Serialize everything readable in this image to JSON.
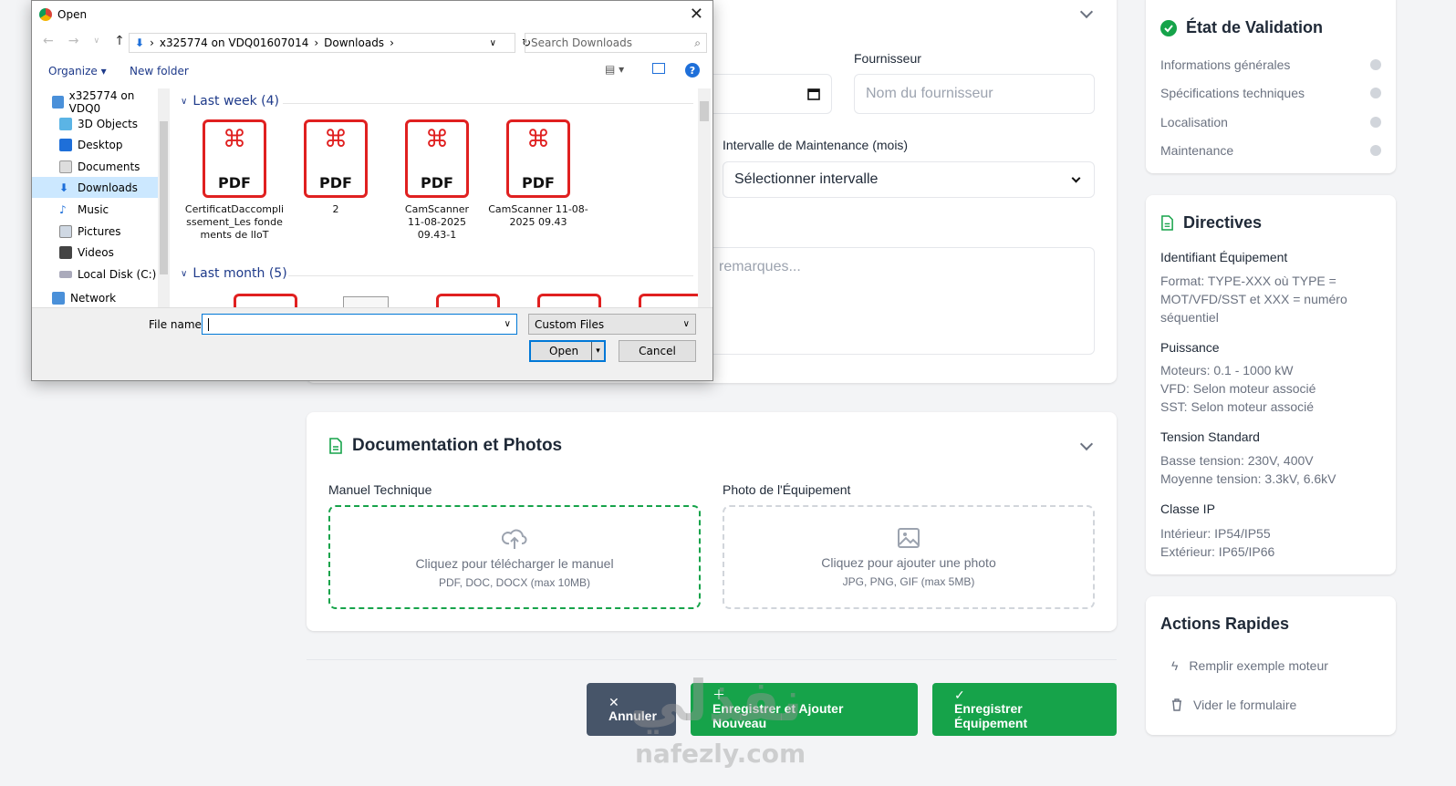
{
  "form": {
    "supplier_label": "Fournisseur",
    "supplier_placeholder": "Nom du fournisseur",
    "maintenance_label": "Intervalle de Maintenance (mois)",
    "maintenance_value": "Sélectionner intervalle",
    "remarks_placeholder": "remarques..."
  },
  "documentation": {
    "title": "Documentation et Photos",
    "manual_label": "Manuel Technique",
    "manual_cta": "Cliquez pour télécharger le manuel",
    "manual_formats": "PDF, DOC, DOCX (max 10MB)",
    "photo_label": "Photo de l'Équipement",
    "photo_cta": "Cliquez pour ajouter une photo",
    "photo_formats": "JPG, PNG, GIF (max 5MB)"
  },
  "buttons": {
    "cancel": "Annuler",
    "save_add": "Enregistrer et Ajouter Nouveau",
    "save": "Enregistrer Équipement"
  },
  "validation": {
    "title": "État de Validation",
    "items": [
      "Informations générales",
      "Spécifications techniques",
      "Localisation",
      "Maintenance"
    ]
  },
  "directives": {
    "title": "Directives",
    "sections": [
      {
        "heading": "Identifiant Équipement",
        "lines": [
          "Format: TYPE-XXX où TYPE = MOT/VFD/SST et XXX = numéro séquentiel"
        ]
      },
      {
        "heading": "Puissance",
        "lines": [
          "Moteurs: 0.1 - 1000 kW",
          "VFD: Selon moteur associé",
          "SST: Selon moteur associé"
        ]
      },
      {
        "heading": "Tension Standard",
        "lines": [
          "Basse tension: 230V, 400V",
          "Moyenne tension: 3.3kV, 6.6kV"
        ]
      },
      {
        "heading": "Classe IP",
        "lines": [
          "Intérieur: IP54/IP55",
          "Extérieur: IP65/IP66"
        ]
      }
    ]
  },
  "actions": {
    "title": "Actions Rapides",
    "fill_example": "Remplir exemple moteur",
    "clear_form": "Vider le formulaire"
  },
  "dialog": {
    "title": "Open",
    "path": [
      "x325774 on VDQ01607014",
      "Downloads"
    ],
    "search_placeholder": "Search Downloads",
    "organize": "Organize",
    "new_folder": "New folder",
    "tree": [
      "x325774 on VDQ0",
      "3D Objects",
      "Desktop",
      "Documents",
      "Downloads",
      "Music",
      "Pictures",
      "Videos",
      "Local Disk (C:)",
      "Network"
    ],
    "group_last_week": "Last week (4)",
    "group_last_month": "Last month (5)",
    "files": [
      {
        "name": "CertificatDaccomplissement_Les fondements de lIoT",
        "badge": "PDF"
      },
      {
        "name": "2",
        "badge": "PDF"
      },
      {
        "name": "CamScanner 11-08-2025 09.43-1",
        "badge": "PDF"
      },
      {
        "name": "CamScanner 11-08-2025 09.43",
        "badge": "PDF"
      }
    ],
    "filename_label": "File name:",
    "filetype": "Custom Files",
    "open_button": "Open",
    "cancel_button": "Cancel"
  },
  "watermark": {
    "arabic": "نفذلي",
    "latin": "nafezly.com"
  },
  "colors": {
    "green": "#16a34a",
    "slate": "#475569",
    "pdf_red": "#e02020"
  }
}
